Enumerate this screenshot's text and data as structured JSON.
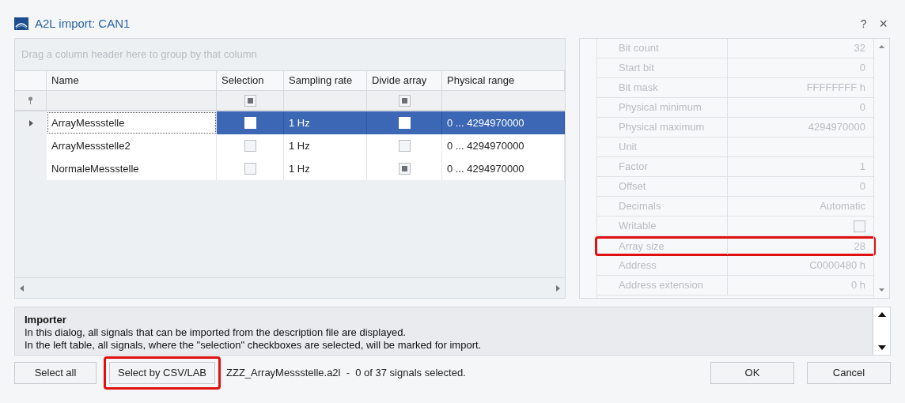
{
  "window": {
    "title": "A2L import: CAN1",
    "help": "?",
    "close": "×"
  },
  "grid": {
    "group_hint": "Drag a column header here to group by that column",
    "columns": [
      "Name",
      "Selection",
      "Sampling rate",
      "Divide array",
      "Physical range"
    ],
    "filter": {
      "selection_checked": true,
      "divide_checked": true
    },
    "rows": [
      {
        "name": "ArrayMessstelle",
        "selection_checked": false,
        "sampling_rate": "1 Hz",
        "divide_checked": false,
        "physical_range": "0 ... 4294970000",
        "selected": true
      },
      {
        "name": "ArrayMessstelle2",
        "selection_checked": false,
        "sampling_rate": "1 Hz",
        "divide_checked": false,
        "physical_range": "0 ... 4294970000",
        "selected": false
      },
      {
        "name": "NormaleMessstelle",
        "selection_checked": false,
        "sampling_rate": "1 Hz",
        "divide_checked": true,
        "physical_range": "0 ... 4294970000",
        "selected": false
      }
    ]
  },
  "properties": [
    {
      "kind": "text",
      "label": "Bit count",
      "value": "32",
      "highlighted": false
    },
    {
      "kind": "text",
      "label": "Start bit",
      "value": "0",
      "highlighted": false
    },
    {
      "kind": "text",
      "label": "Bit mask",
      "value": "FFFFFFFF h",
      "highlighted": false
    },
    {
      "kind": "text",
      "label": "Physical minimum",
      "value": "0",
      "highlighted": false
    },
    {
      "kind": "text",
      "label": "Physical maximum",
      "value": "4294970000",
      "highlighted": false
    },
    {
      "kind": "text",
      "label": "Unit",
      "highlighted": false
    },
    {
      "kind": "text",
      "label": "Factor",
      "value": "1",
      "highlighted": false
    },
    {
      "kind": "text",
      "label": "Offset",
      "value": "0",
      "highlighted": false
    },
    {
      "kind": "text",
      "label": "Decimals",
      "value": "Automatic",
      "highlighted": false
    },
    {
      "kind": "checkbox",
      "label": "Writable",
      "checked": false,
      "highlighted": false
    },
    {
      "kind": "text",
      "label": "Array size",
      "value": "28",
      "highlighted": true
    },
    {
      "kind": "text",
      "label": "Address",
      "value": "C0000480 h",
      "highlighted": false
    },
    {
      "kind": "text",
      "label": "Address extension",
      "value": "0 h",
      "highlighted": false
    }
  ],
  "help": {
    "title": "Importer",
    "lines": [
      "In this dialog, all signals that can be imported from the description file are displayed.",
      "In the left table, all signals, where the \"selection\" checkboxes are selected, will be marked for import."
    ]
  },
  "footer": {
    "buttons_left": [
      {
        "label": "Select all",
        "highlighted": false
      },
      {
        "label": "Select by CSV/LAB",
        "highlighted": true
      }
    ],
    "status": "ZZZ_ArrayMessstelle.a2l  -  0 of 37 signals selected.",
    "buttons_right": [
      "OK",
      "Cancel"
    ]
  }
}
